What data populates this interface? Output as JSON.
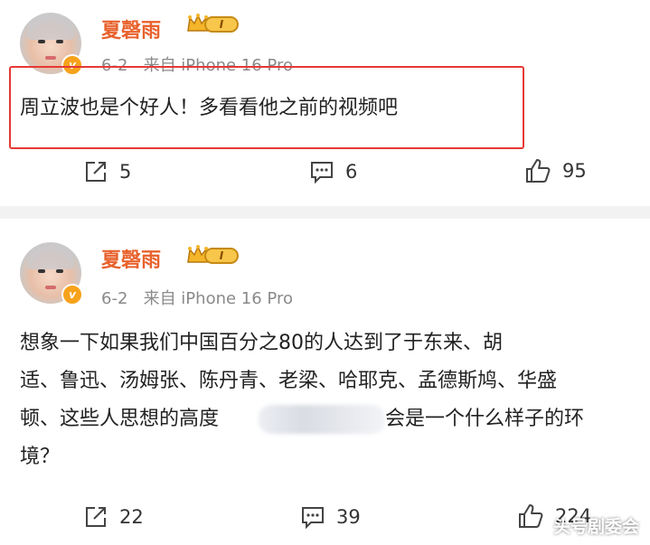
{
  "comments": [
    {
      "username": "夏磬雨",
      "level": "I",
      "verified_mark": "v",
      "date": "6-2",
      "source": "来自 iPhone 16 Pro",
      "text": "周立波也是个好人！多看看他之前的视频吧",
      "share_count": "5",
      "comment_count": "6",
      "like_count": "95"
    },
    {
      "username": "夏磬雨",
      "level": "I",
      "verified_mark": "v",
      "date": "6-2",
      "source": "来自 iPhone 16 Pro",
      "text_lines": [
        "想象一下如果我们中国百分之80的人达到了于东来、胡",
        "适、鲁迅、汤姆张、陈丹青、老梁、哈耶克、孟德斯鸠、华盛",
        "顿、这些人思想的高度",
        "会是一个什么样子的环",
        "境？"
      ],
      "share_count": "22",
      "comment_count": "39",
      "like_count": "224"
    }
  ],
  "watermark": "头号剧委会",
  "colors": {
    "username": "#e8622d",
    "highlight_border": "#e53935",
    "meta_text": "#8a8a8a",
    "separator": "#f2f2f2"
  },
  "icons": [
    "avatar",
    "verified-badge-icon",
    "crown-level-badge-icon",
    "share-icon",
    "comment-icon",
    "like-icon"
  ]
}
